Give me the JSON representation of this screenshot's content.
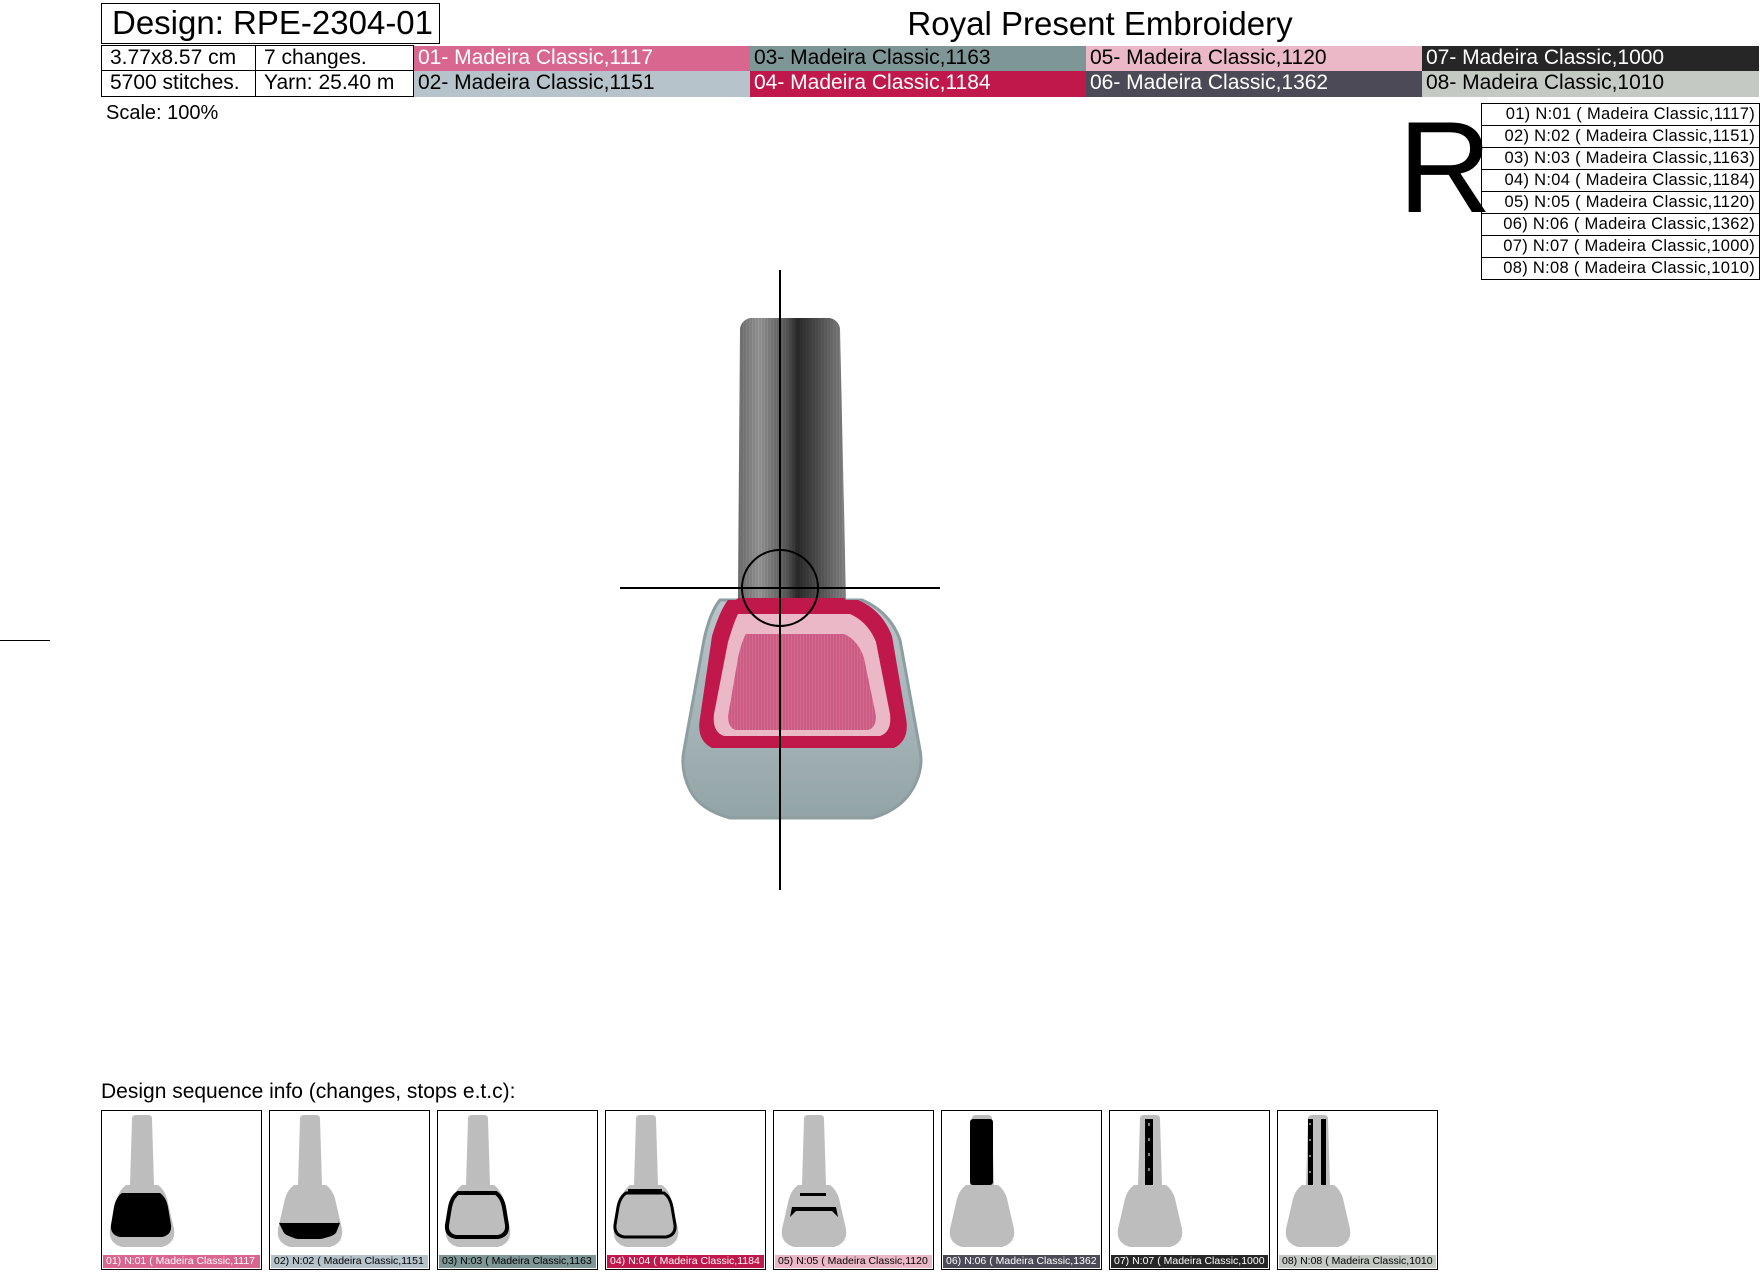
{
  "header": {
    "design_label": "Design: RPE-2304-01",
    "brand": "Royal Present Embroidery",
    "size": "3.77x8.57 cm",
    "changes": "7 changes.",
    "stitches": "5700 stitches.",
    "yarn": "Yarn: 25.40 m"
  },
  "threads": [
    {
      "label": "01- Madeira Classic,1117",
      "color": "#d9668f",
      "text_color": "#ffffff"
    },
    {
      "label": "02- Madeira Classic,1151",
      "color": "#b6c3cb",
      "text_color": "#000000"
    },
    {
      "label": "03- Madeira Classic,1163",
      "color": "#7f9696",
      "text_color": "#000000"
    },
    {
      "label": "04- Madeira Classic,1184",
      "color": "#c0184a",
      "text_color": "#ffffff"
    },
    {
      "label": "05- Madeira Classic,1120",
      "color": "#ebb8c8",
      "text_color": "#000000"
    },
    {
      "label": "06- Madeira Classic,1362",
      "color": "#4d4a57",
      "text_color": "#ffffff"
    },
    {
      "label": "07- Madeira Classic,1000",
      "color": "#262626",
      "text_color": "#ffffff"
    },
    {
      "label": "08- Madeira Classic,1010",
      "color": "#c4c9c4",
      "text_color": "#000000"
    }
  ],
  "scale": "Scale: 100%",
  "orientation_mark": "R",
  "legend": [
    "01) N:01 ( Madeira Classic,1117)",
    "02) N:02 ( Madeira Classic,1151)",
    "03) N:03 ( Madeira Classic,1163)",
    "04) N:04 ( Madeira Classic,1184)",
    "05) N:05 ( Madeira Classic,1120)",
    "06) N:06 ( Madeira Classic,1362)",
    "07) N:07 ( Madeira Classic,1000)",
    "08) N:08 ( Madeira Classic,1010)"
  ],
  "sequence": {
    "title": "Design sequence info (changes, stops e.t.c):",
    "steps": [
      {
        "label": "01) N:01 ( Madeira Classic,1117",
        "highlight": "bottle-fill"
      },
      {
        "label": "02) N:02 ( Madeira Classic,1151",
        "highlight": "bottle-base"
      },
      {
        "label": "03) N:03 ( Madeira Classic,1163",
        "highlight": "bottle-outline"
      },
      {
        "label": "04) N:04 ( Madeira Classic,1184",
        "highlight": "bottle-rim"
      },
      {
        "label": "05) N:05 ( Madeira Classic,1120",
        "highlight": "bottle-shine"
      },
      {
        "label": "06) N:06 ( Madeira Classic,1362",
        "highlight": "cap-fill"
      },
      {
        "label": "07) N:07 ( Madeira Classic,1000",
        "highlight": "cap-stripe"
      },
      {
        "label": "08) N:08 ( Madeira Classic,1010",
        "highlight": "cap-highlights"
      }
    ]
  }
}
